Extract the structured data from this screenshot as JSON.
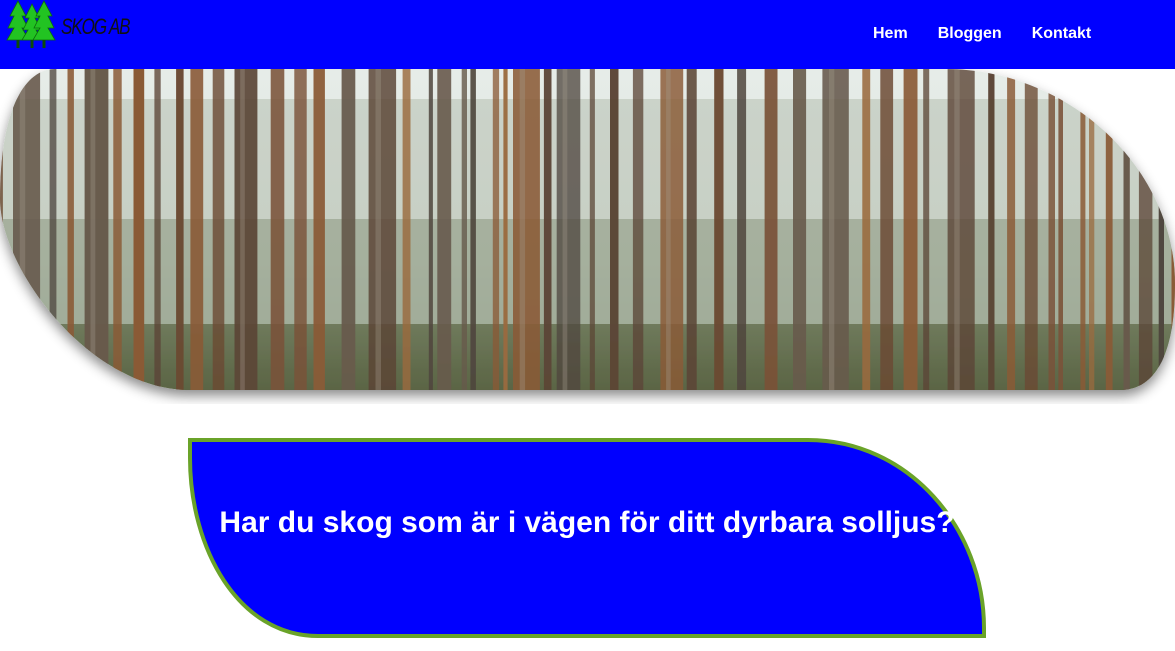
{
  "brand": {
    "logo_text": "SKOG AB",
    "logo_icon": "pine-trees-icon"
  },
  "nav": {
    "items": [
      {
        "label": "Hem"
      },
      {
        "label": "Bloggen"
      },
      {
        "label": "Kontakt"
      }
    ]
  },
  "hero": {
    "image": "pine-forest-photo"
  },
  "banner": {
    "title": "Har du skog som är i vägen för ditt dyrbara solljus?"
  },
  "colors": {
    "primary_blue": "#0000ff",
    "accent_green": "#6aa329",
    "logo_green": "#22c322",
    "text_light": "#ffffff"
  }
}
